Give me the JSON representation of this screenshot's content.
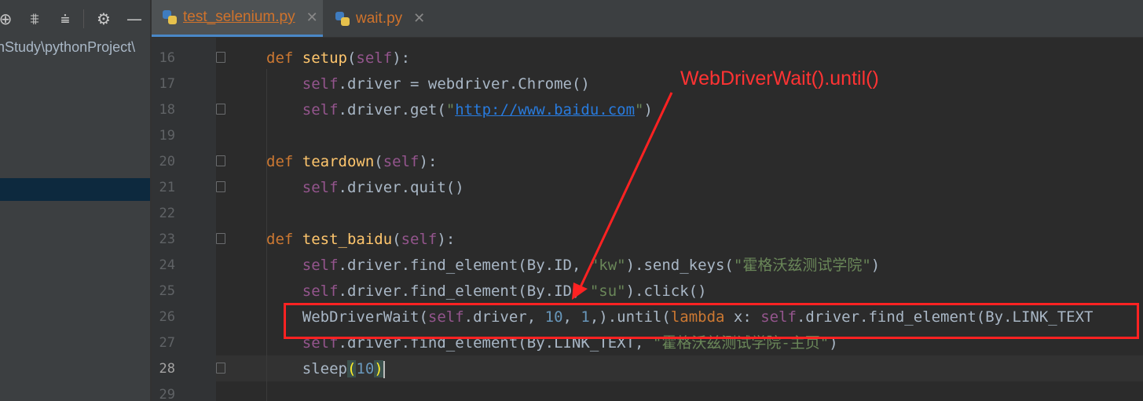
{
  "sidebar": {
    "project_path": "nStudy\\pythonProject\\",
    "toolbar_icons": [
      "locate-icon",
      "expand-all-icon",
      "collapse-all-icon",
      "gear-icon",
      "hide-icon"
    ]
  },
  "tabs": [
    {
      "label": "test_selenium.py",
      "active": true
    },
    {
      "label": "wait.py",
      "active": false
    }
  ],
  "editor": {
    "line_numbers": [
      "16",
      "17",
      "18",
      "19",
      "20",
      "21",
      "22",
      "23",
      "24",
      "25",
      "26",
      "27",
      "28",
      "29"
    ],
    "current_line": "28"
  },
  "annotation": {
    "label": "WebDriverWait().until()",
    "color": "#ff2222"
  },
  "colors": {
    "keyword": "#cc7832",
    "function": "#ffc66d",
    "self": "#94558d",
    "string": "#6a8759",
    "number": "#6897bb",
    "link": "#287bde"
  }
}
